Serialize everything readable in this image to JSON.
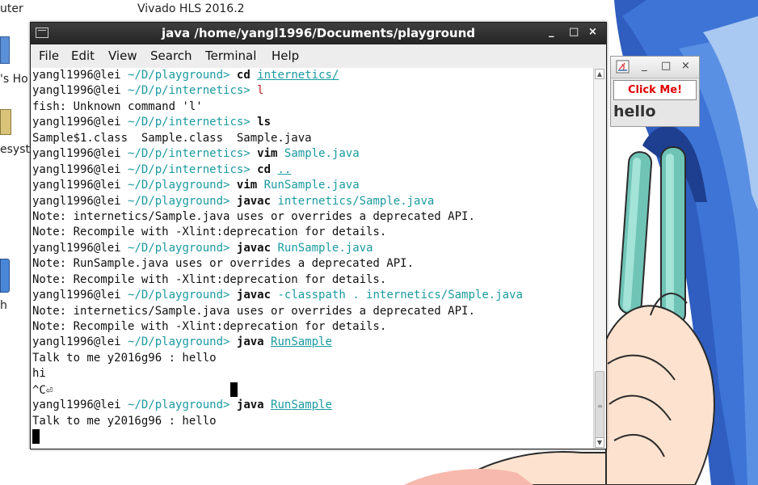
{
  "desktop": {
    "labels": [
      "uter",
      "Vivado HLS 2016.2",
      "'s Ho",
      "esyst",
      "h"
    ]
  },
  "terminal": {
    "title": "java  /home/yangl1996/Documents/playground",
    "controls": [
      "_",
      "□",
      "×"
    ],
    "menu": [
      "File",
      "Edit",
      "View",
      "Search",
      "Terminal",
      "Help"
    ],
    "prompt_user": "yangl1996@lei",
    "lines": [
      {
        "type": "cmd",
        "path": "~/D/playground>",
        "cmd": "cd",
        "args": [
          {
            "t": "internetics/",
            "s": "u"
          }
        ]
      },
      {
        "type": "cmd",
        "path": "~/D/p/internetics>",
        "cmd": "l",
        "cmd_style": "r",
        "args": []
      },
      {
        "type": "out",
        "text": "fish: Unknown command 'l'"
      },
      {
        "type": "cmd",
        "path": "~/D/p/internetics>",
        "cmd": "ls",
        "args": []
      },
      {
        "type": "out",
        "text": "Sample$1.class  Sample.class  Sample.java"
      },
      {
        "type": "cmd",
        "path": "~/D/p/internetics>",
        "cmd": "vim",
        "args": [
          {
            "t": "Sample.java",
            "s": "c"
          }
        ]
      },
      {
        "type": "cmd",
        "path": "~/D/p/internetics>",
        "cmd": "cd",
        "args": [
          {
            "t": "..",
            "s": "u"
          }
        ]
      },
      {
        "type": "cmd",
        "path": "~/D/playground>",
        "cmd": "vim",
        "args": [
          {
            "t": "RunSample.java",
            "s": "c"
          }
        ]
      },
      {
        "type": "cmd",
        "path": "~/D/playground>",
        "cmd": "javac",
        "args": [
          {
            "t": "internetics/Sample.java",
            "s": "c"
          }
        ]
      },
      {
        "type": "out",
        "text": "Note: internetics/Sample.java uses or overrides a deprecated API."
      },
      {
        "type": "out",
        "text": "Note: Recompile with -Xlint:deprecation for details."
      },
      {
        "type": "cmd",
        "path": "~/D/playground>",
        "cmd": "javac",
        "args": [
          {
            "t": "RunSample.java",
            "s": "c"
          }
        ]
      },
      {
        "type": "out",
        "text": "Note: RunSample.java uses or overrides a deprecated API."
      },
      {
        "type": "out",
        "text": "Note: Recompile with -Xlint:deprecation for details."
      },
      {
        "type": "cmd",
        "path": "~/D/playground>",
        "cmd": "javac",
        "args": [
          {
            "t": "-classpath . internetics/Sample.java",
            "s": "c"
          }
        ]
      },
      {
        "type": "out",
        "text": "Note: internetics/Sample.java uses or overrides a deprecated API."
      },
      {
        "type": "out",
        "text": "Note: Recompile with -Xlint:deprecation for details."
      },
      {
        "type": "cmd",
        "path": "~/D/playground>",
        "cmd": "java",
        "args": [
          {
            "t": "RunSample",
            "s": "u"
          }
        ]
      },
      {
        "type": "out",
        "text": "Talk to me y2016g96 : hello"
      },
      {
        "type": "out",
        "text": "hi"
      },
      {
        "type": "ctrlc",
        "text": "^C⏎"
      },
      {
        "type": "cmd",
        "path": "~/D/playground>",
        "cmd": "java",
        "args": [
          {
            "t": "RunSample",
            "s": "u"
          }
        ]
      },
      {
        "type": "out",
        "text": "Talk to me y2016g96 : hello"
      },
      {
        "type": "cursor"
      }
    ]
  },
  "java_window": {
    "controls": [
      "_",
      "□",
      "×"
    ],
    "button_label": "Click Me!",
    "label_text": "hello"
  }
}
